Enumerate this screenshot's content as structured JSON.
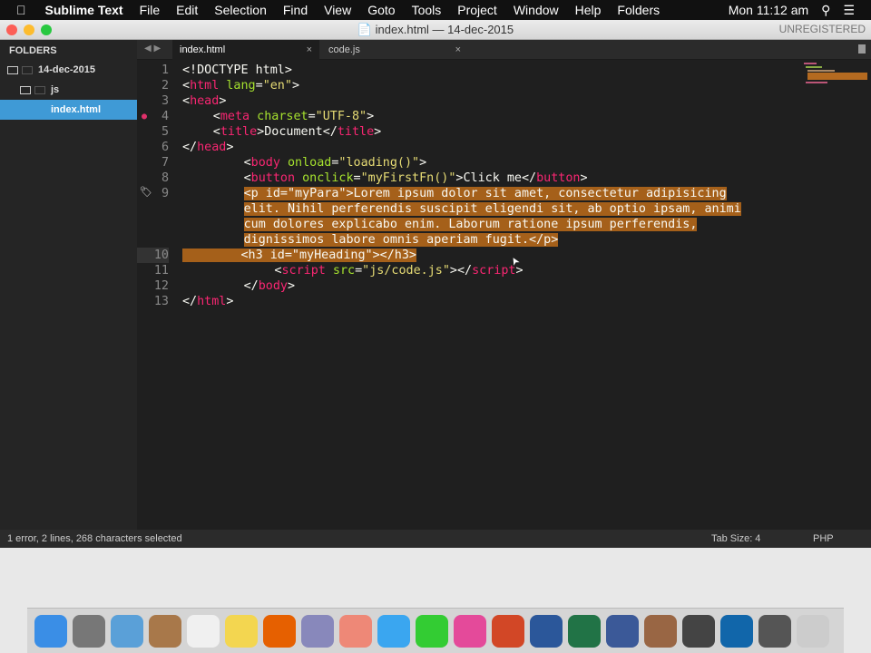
{
  "menubar": {
    "app": "Sublime Text",
    "items": [
      "File",
      "Edit",
      "Selection",
      "Find",
      "View",
      "Goto",
      "Tools",
      "Project",
      "Window",
      "Help",
      "Folders"
    ],
    "clock": "Mon 11:12 am"
  },
  "window": {
    "title": "index.html — 14-dec-2015",
    "unregistered": "UNREGISTERED"
  },
  "sidebar": {
    "header": "FOLDERS",
    "root": "14-dec-2015",
    "sub": "js",
    "file": "index.html"
  },
  "tabs": [
    {
      "label": "index.html"
    },
    {
      "label": "code.js"
    }
  ],
  "tab_close": "×",
  "code": [
    {
      "n": "1",
      "indent": 0,
      "tokens": [
        [
          "p",
          "<!DOCTYPE html>"
        ]
      ]
    },
    {
      "n": "2",
      "indent": 0,
      "tokens": [
        [
          "p",
          "<"
        ],
        [
          "tag",
          "html"
        ],
        [
          "p",
          " "
        ],
        [
          "attr",
          "lang"
        ],
        [
          "p",
          "="
        ],
        [
          "str",
          "\"en\""
        ],
        [
          "p",
          ">"
        ]
      ]
    },
    {
      "n": "3",
      "indent": 0,
      "tokens": [
        [
          "p",
          "<"
        ],
        [
          "tag",
          "head"
        ],
        [
          "p",
          ">"
        ]
      ]
    },
    {
      "n": "4",
      "indent": 4,
      "tokens": [
        [
          "p",
          "<"
        ],
        [
          "tag",
          "meta"
        ],
        [
          "p",
          " "
        ],
        [
          "attr",
          "charset"
        ],
        [
          "p",
          "="
        ],
        [
          "str",
          "\"UTF-8\""
        ],
        [
          "p",
          ">"
        ]
      ]
    },
    {
      "n": "5",
      "indent": 4,
      "tokens": [
        [
          "p",
          "<"
        ],
        [
          "tag",
          "title"
        ],
        [
          "p",
          ">Document</"
        ],
        [
          "tag",
          "title"
        ],
        [
          "p",
          ">"
        ]
      ]
    },
    {
      "n": "6",
      "indent": 0,
      "tokens": [
        [
          "p",
          "</"
        ],
        [
          "tag",
          "head"
        ],
        [
          "p",
          ">"
        ]
      ]
    },
    {
      "n": "7",
      "indent": 8,
      "tokens": [
        [
          "p",
          "<"
        ],
        [
          "tag",
          "body"
        ],
        [
          "p",
          " "
        ],
        [
          "attr",
          "onload"
        ],
        [
          "p",
          "="
        ],
        [
          "str",
          "\"loading()\""
        ],
        [
          "p",
          ">"
        ]
      ]
    },
    {
      "n": "8",
      "indent": 8,
      "tokens": [
        [
          "p",
          "<"
        ],
        [
          "tag",
          "button"
        ],
        [
          "p",
          " "
        ],
        [
          "attr",
          "onclick"
        ],
        [
          "p",
          "="
        ],
        [
          "str",
          "\"myFirstFn()\""
        ],
        [
          "p",
          ">Click me</"
        ],
        [
          "tag",
          "button"
        ],
        [
          "p",
          ">"
        ]
      ]
    },
    {
      "n": "9",
      "indent": 8,
      "selected": true,
      "wrap": [
        "<p id=\"myPara\">Lorem ipsum dolor sit amet, consectetur adipisicing",
        "elit. Nihil perferendis suscipit eligendi sit, ab optio ipsam, animi",
        "cum dolores explicabo enim. Laborum ratione ipsum perferendis,",
        "dignissimos labore omnis aperiam fugit.</p>"
      ]
    },
    {
      "n": "10",
      "indent": 8,
      "selected": true,
      "tokens": [
        [
          "p",
          "<h3 id=\"myHeading\"></h3>"
        ]
      ]
    },
    {
      "n": "11",
      "indent": 12,
      "tokens": [
        [
          "p",
          "<"
        ],
        [
          "tag",
          "script"
        ],
        [
          "p",
          " "
        ],
        [
          "attr",
          "src"
        ],
        [
          "p",
          "="
        ],
        [
          "str",
          "\"js/code.js\""
        ],
        [
          "p",
          "></"
        ],
        [
          "tag",
          "script"
        ],
        [
          "p",
          ">"
        ]
      ]
    },
    {
      "n": "12",
      "indent": 8,
      "tokens": [
        [
          "p",
          "</"
        ],
        [
          "tag",
          "body"
        ],
        [
          "p",
          ">"
        ]
      ]
    },
    {
      "n": "13",
      "indent": 0,
      "tokens": [
        [
          "p",
          "</"
        ],
        [
          "tag",
          "html"
        ],
        [
          "p",
          ">"
        ]
      ]
    }
  ],
  "status": {
    "left": "1 error, 2 lines, 268 characters selected",
    "tab_size": "Tab Size: 4",
    "syntax": "PHP"
  },
  "dock": [
    {
      "name": "finder",
      "color": "#3a8ee6"
    },
    {
      "name": "launchpad",
      "color": "#777"
    },
    {
      "name": "mail",
      "color": "#5aa0d8"
    },
    {
      "name": "contacts",
      "color": "#a8784a"
    },
    {
      "name": "reminders",
      "color": "#f0f0f0"
    },
    {
      "name": "notes",
      "color": "#f3d650"
    },
    {
      "name": "firefox",
      "color": "#e66000"
    },
    {
      "name": "preview",
      "color": "#88b"
    },
    {
      "name": "photos",
      "color": "#e87"
    },
    {
      "name": "messages",
      "color": "#3aa6f0"
    },
    {
      "name": "facetime",
      "color": "#3c3"
    },
    {
      "name": "itunes",
      "color": "#e44a9a"
    },
    {
      "name": "powerpoint",
      "color": "#d24726"
    },
    {
      "name": "word",
      "color": "#2b579a"
    },
    {
      "name": "excel",
      "color": "#217346"
    },
    {
      "name": "facebook",
      "color": "#3b5998"
    },
    {
      "name": "photo",
      "color": "#964"
    },
    {
      "name": "sublime",
      "color": "#444"
    },
    {
      "name": "quicktime",
      "color": "#16a"
    },
    {
      "name": "scanner",
      "color": "#555"
    },
    {
      "name": "trash",
      "color": "#ccc"
    }
  ]
}
